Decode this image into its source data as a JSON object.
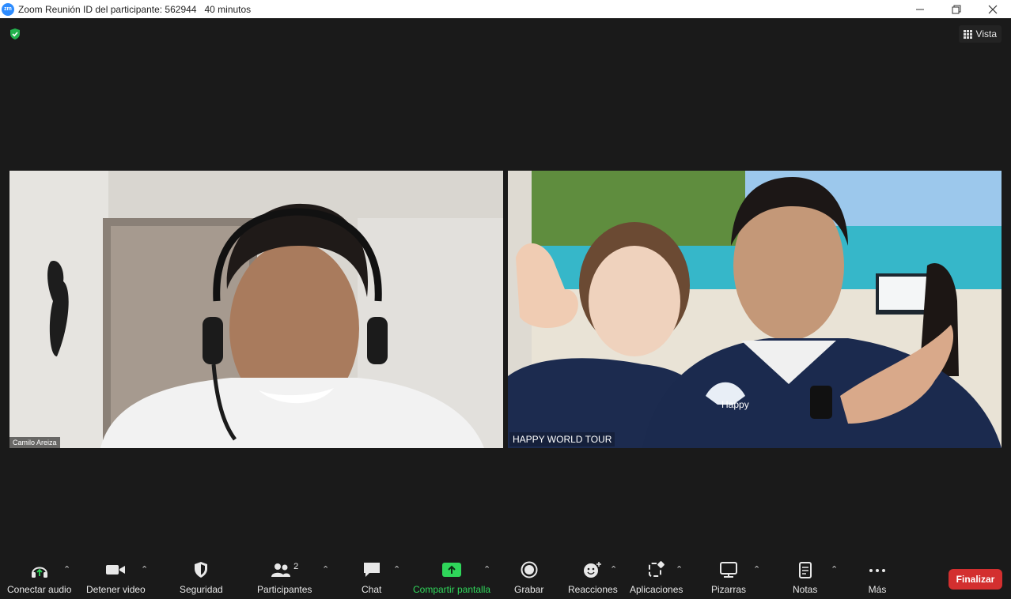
{
  "window": {
    "title": "Zoom Reunión ID del participante: 562944   40 minutos",
    "logo_text": "zm"
  },
  "stage": {
    "view_label": "Vista"
  },
  "participants": [
    {
      "name": "Camilo Areiza"
    },
    {
      "name": "HAPPY WORLD TOUR",
      "shirt_logo": "Happy"
    }
  ],
  "toolbar": {
    "audio": "Conectar audio",
    "video": "Detener video",
    "security": "Seguridad",
    "participants": "Participantes",
    "participants_count": "2",
    "chat": "Chat",
    "share": "Compartir pantalla",
    "record": "Grabar",
    "reactions": "Reacciones",
    "apps": "Aplicaciones",
    "whiteboards": "Pizarras",
    "notes": "Notas",
    "more": "Más",
    "end": "Finalizar"
  },
  "colors": {
    "background": "#1a1a1a",
    "accent_green": "#2fd65a",
    "end_red": "#d32f2f",
    "zoom_blue": "#2d8cff"
  }
}
